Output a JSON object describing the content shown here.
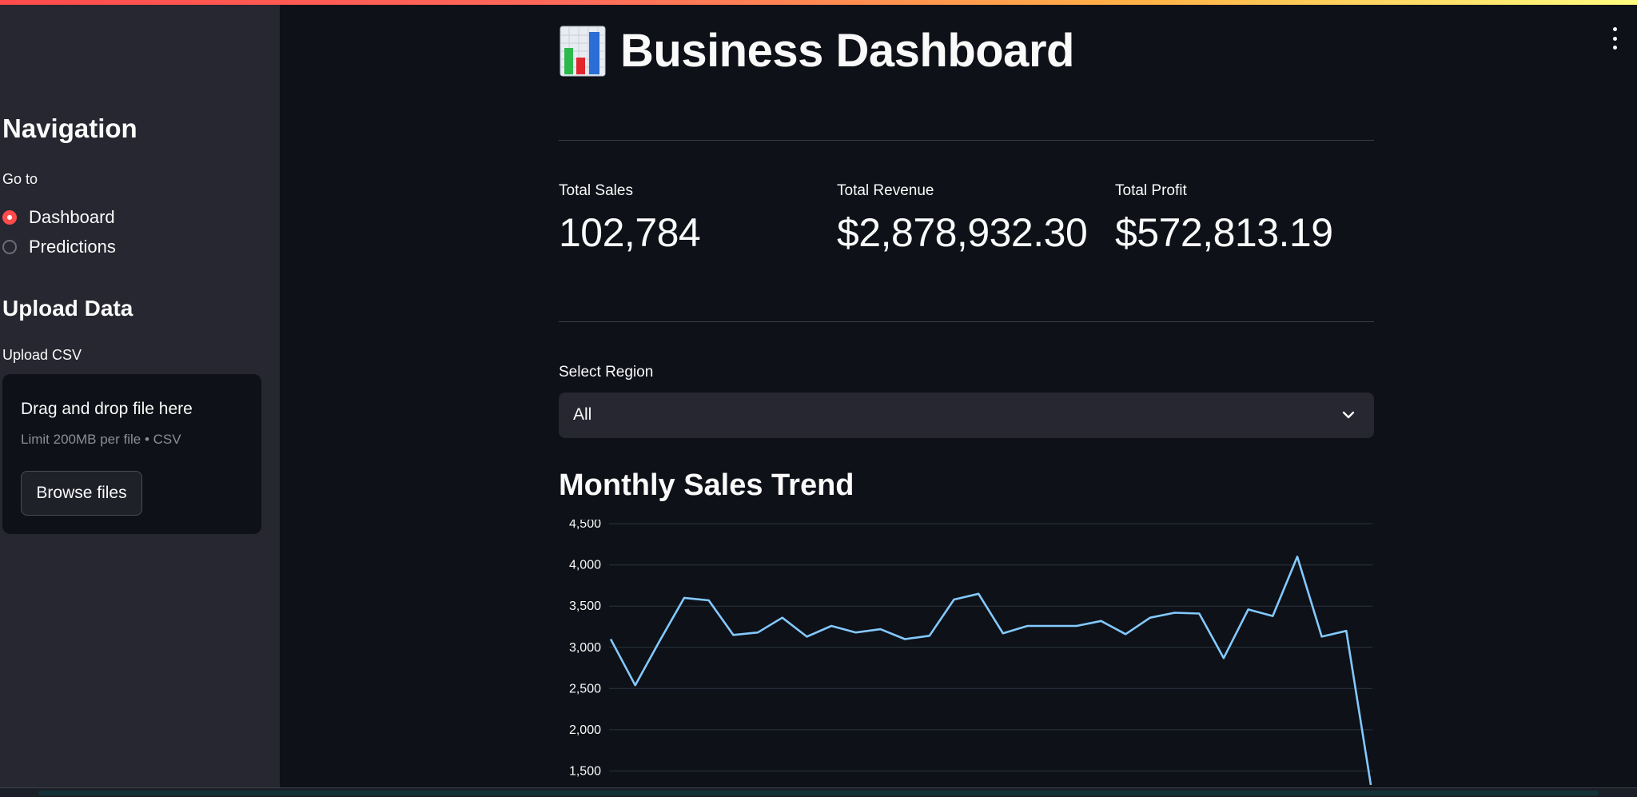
{
  "sidebar": {
    "nav_title": "Navigation",
    "goto_label": "Go to",
    "nav_options": [
      {
        "label": "Dashboard",
        "selected": true
      },
      {
        "label": "Predictions",
        "selected": false
      }
    ],
    "upload_title": "Upload Data",
    "upload_label": "Upload CSV",
    "dropzone": {
      "title": "Drag and drop file here",
      "limit": "Limit 200MB per file • CSV",
      "browse_label": "Browse files"
    }
  },
  "header": {
    "icon": "bar-chart-icon",
    "title": "Business Dashboard",
    "menu_icon": "kebab-menu-icon"
  },
  "metrics": [
    {
      "label": "Total Sales",
      "value": "102,784"
    },
    {
      "label": "Total Revenue",
      "value": "$2,878,932.30"
    },
    {
      "label": "Total Profit",
      "value": "$572,813.19"
    }
  ],
  "region_select": {
    "label": "Select Region",
    "value": "All"
  },
  "chart_section": {
    "title": "Monthly Sales Trend"
  },
  "colors": {
    "accent": "#ff4b4b",
    "background": "#0e1117",
    "sidebar": "#262730",
    "line": "#83c9ff",
    "grid": "#2c3440"
  },
  "chart_data": {
    "type": "line",
    "title": "",
    "xlabel": "",
    "ylabel": "",
    "ylim": [
      1300,
      4550
    ],
    "yticks": [
      1500,
      2000,
      2500,
      3000,
      3500,
      4000,
      4500
    ],
    "ytick_labels": [
      "1,500",
      "2,000",
      "2,500",
      "3,000",
      "3,500",
      "4,000",
      "4,500"
    ],
    "grid": true,
    "series": [
      {
        "values": [
          3100,
          2540,
          3080,
          3600,
          3570,
          3150,
          3180,
          3360,
          3130,
          3260,
          3180,
          3220,
          3100,
          3140,
          3580,
          3650,
          3170,
          3260,
          3260,
          3260,
          3320,
          3160,
          3360,
          3420,
          3410,
          2870,
          3460,
          3380,
          4100,
          3130,
          3200,
          1330
        ]
      }
    ]
  }
}
